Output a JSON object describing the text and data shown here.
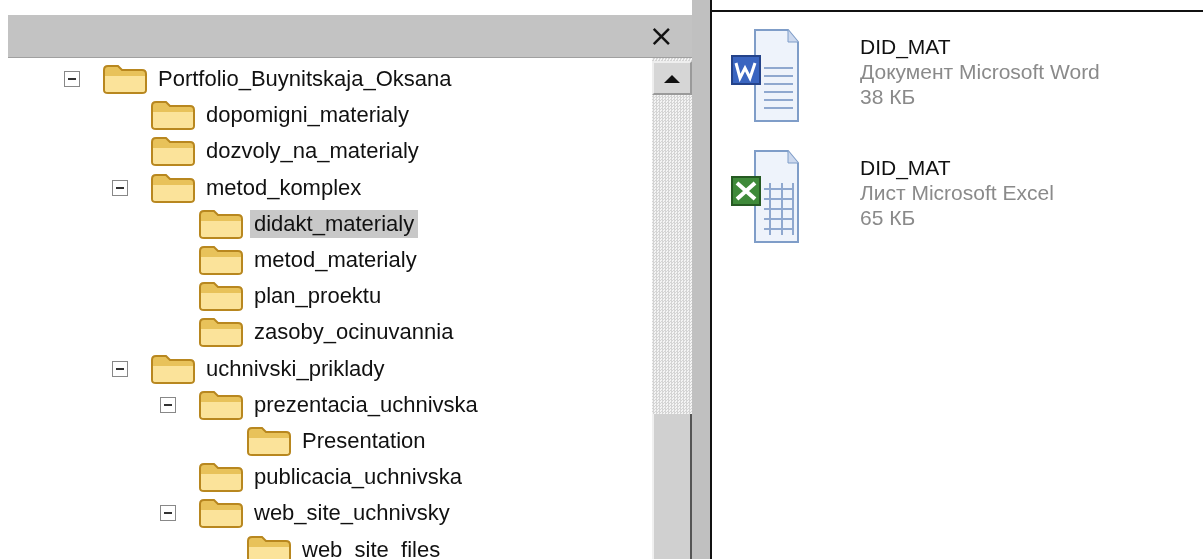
{
  "tree_pane": {
    "close": "×",
    "tree": [
      {
        "label": "Portfolio_Buynitskaja_Oksana",
        "expanded": true,
        "selected": false,
        "children": [
          {
            "label": "dopomigni_materialy",
            "selected": false
          },
          {
            "label": "dozvoly_na_materialy",
            "selected": false
          },
          {
            "label": "metod_komplex",
            "expanded": true,
            "selected": false,
            "children": [
              {
                "label": "didakt_materialy",
                "selected": true
              },
              {
                "label": "metod_materialy",
                "selected": false
              },
              {
                "label": "plan_proektu",
                "selected": false
              },
              {
                "label": "zasoby_ocinuvannia",
                "selected": false
              }
            ]
          },
          {
            "label": "uchnivski_priklady",
            "expanded": true,
            "selected": false,
            "children": [
              {
                "label": "prezentacia_uchnivska",
                "expanded": true,
                "selected": false,
                "children": [
                  {
                    "label": "Presentation",
                    "selected": false
                  }
                ]
              },
              {
                "label": "publicacia_uchnivska",
                "selected": false
              },
              {
                "label": "web_site_uchnivsky",
                "expanded": true,
                "selected": false,
                "children": [
                  {
                    "label": "web_site_files",
                    "selected": false
                  }
                ]
              }
            ]
          }
        ]
      }
    ]
  },
  "files": [
    {
      "kind": "word",
      "name": "DID_MAT",
      "type": "Документ Microsoft Word",
      "size": "38 КБ"
    },
    {
      "kind": "excel",
      "name": "DID_MAT",
      "type": "Лист Microsoft Excel",
      "size": "65 КБ"
    }
  ]
}
